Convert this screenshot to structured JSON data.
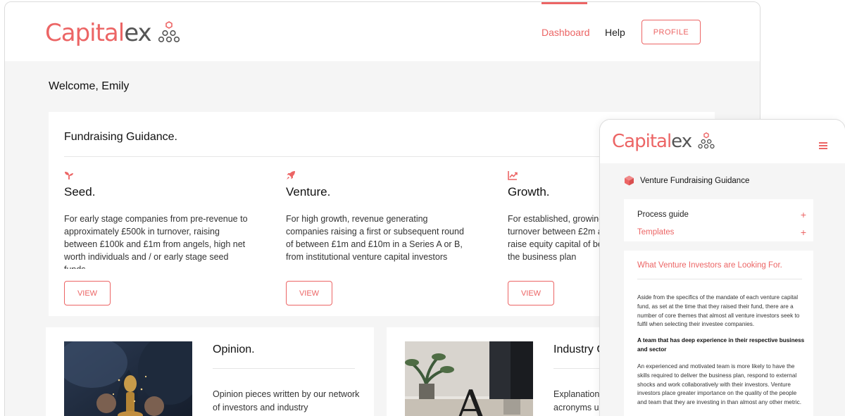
{
  "brand": {
    "name_part1": "Capital",
    "name_part2": "ex",
    "accent_color": "#ec6565",
    "text_color": "#555555"
  },
  "desktop": {
    "nav": {
      "dashboard": "Dashboard",
      "help": "Help",
      "profile": "PROFILE"
    },
    "welcome": "Welcome, Emily",
    "guidance": {
      "title": "Fundraising Guidance.",
      "columns": [
        {
          "icon": "seedling-icon",
          "title": "Seed.",
          "text": "For early stage companies from pre-revenue to approximately £500k in turnover, raising between £100k and £1m from angels, high net worth individuals and / or early stage seed funds",
          "button": "VIEW"
        },
        {
          "icon": "rocket-icon",
          "title": "Venture.",
          "text": "For high growth, revenue generating companies raising a first or subsequent round of between £1m and £10m in a Series A or B, from institutional venture capital investors",
          "button": "VIEW"
        },
        {
          "icon": "growth-chart-icon",
          "title": "Growth.",
          "text": "For established, growing companies with turnover between £2m and £10m looking to raise equity capital of between to accelerate the business plan",
          "button": "VIEW"
        }
      ]
    },
    "opinion": {
      "title": "Opinion.",
      "text": "Opinion pieces written by our network of investors and industry professionals."
    },
    "industry": {
      "title": "Industry Glossary.",
      "text": "Explanations of common terms and acronyms used in the industry."
    }
  },
  "mobile": {
    "heading": "Venture Fundraising Guidance",
    "menu": [
      {
        "label": "Process guide",
        "active": false
      },
      {
        "label": "Templates",
        "active": true
      }
    ],
    "article": {
      "title": "What Venture Investors are Looking For.",
      "para1": "Aside from the specifics of the mandate of each venture capital fund, as set at the time that they raised their fund, there are a number of core themes that almost all venture investors seek to fulfil when selecting their investee companies.",
      "subheading": "A team that has deep experience in their respective business and sector",
      "para2": "An experienced and motivated team is more likely to have the skills required to deliver the business plan, respond to external shocks and work collaboratively with their investors. Venture investors place greater importance on the quality of the people and team that they are investing in than almost any other metric."
    }
  }
}
